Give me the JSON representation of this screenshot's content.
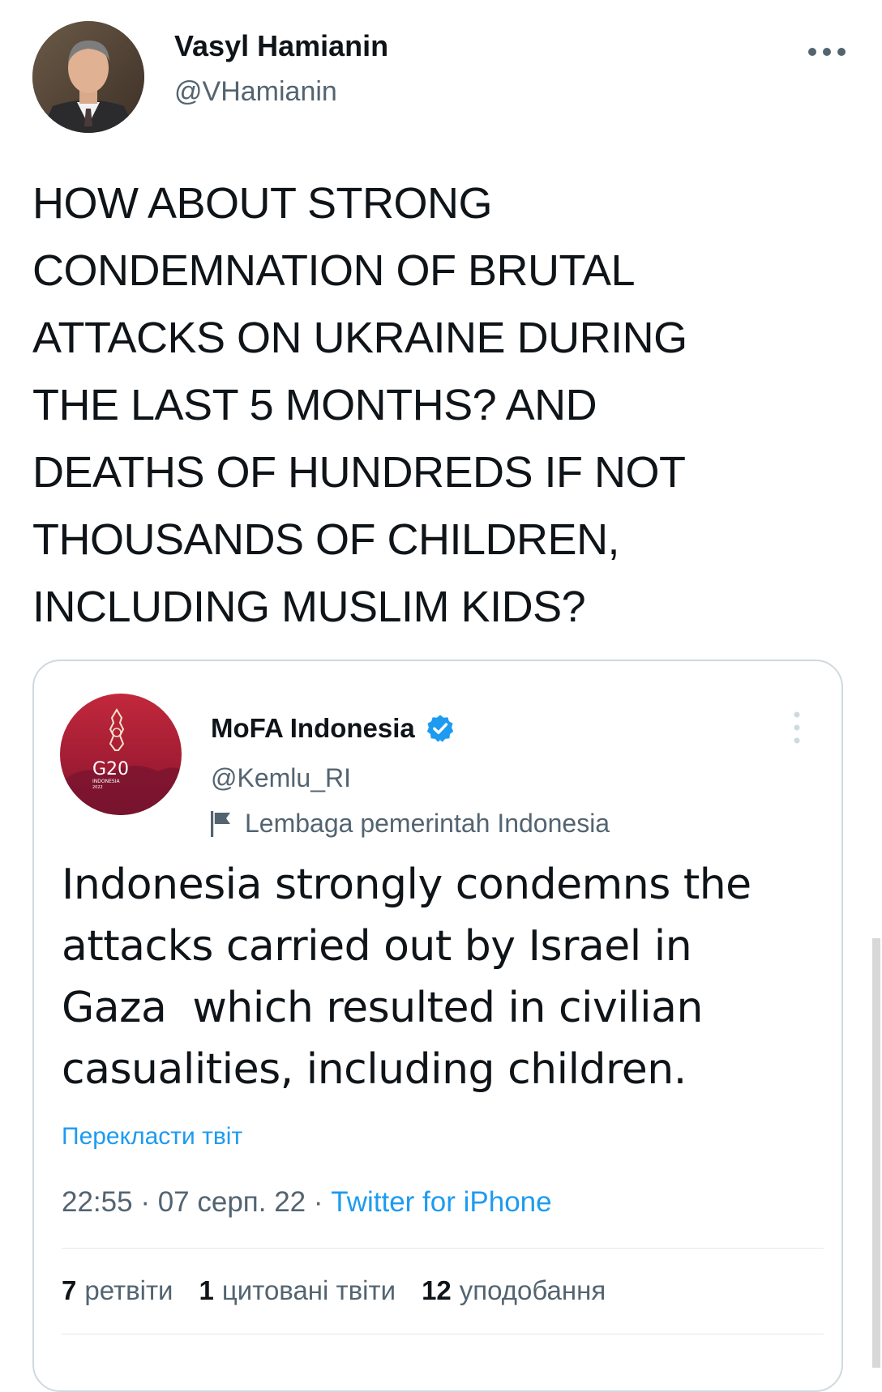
{
  "author": {
    "name": "Vasyl Hamianin",
    "handle": "@VHamianin"
  },
  "tweet": {
    "lines": [
      "HOW ABOUT STRONG",
      "CONDEMNATION OF BRUTAL",
      "ATTACKS ON UKRAINE DURING",
      "THE LAST 5 MONTHS? AND",
      "DEATHS OF HUNDREDS IF NOT",
      "THOUSANDS OF CHILDREN,",
      "INCLUDING MUSLIM KIDS?"
    ]
  },
  "quoted": {
    "name": "MoFA Indonesia",
    "handle": "@Kemlu_RI",
    "label": "Lembaga pemerintah Indonesia",
    "avatar_text": "G20",
    "avatar_subtext": "INDONESIA",
    "avatar_year": "2022",
    "lines": [
      "Indonesia strongly condemns the",
      "attacks carried out by Israel in",
      "Gaza  which resulted in civilian",
      "casualities, including children."
    ],
    "translate_label": "Перекласти твіт",
    "time": "22:55",
    "date": "07 серп. 22",
    "source": "Twitter for iPhone",
    "stats": {
      "retweets_count": "7",
      "retweets_label": "ретвіти",
      "quotes_count": "1",
      "quotes_label": "цитовані твіти",
      "likes_count": "12",
      "likes_label": "уподобання"
    }
  },
  "colors": {
    "accent": "#1d9bf0",
    "text": "#0f1419",
    "secondary": "#536471",
    "border": "#cfd9de",
    "g20_red": "#b21f35"
  }
}
